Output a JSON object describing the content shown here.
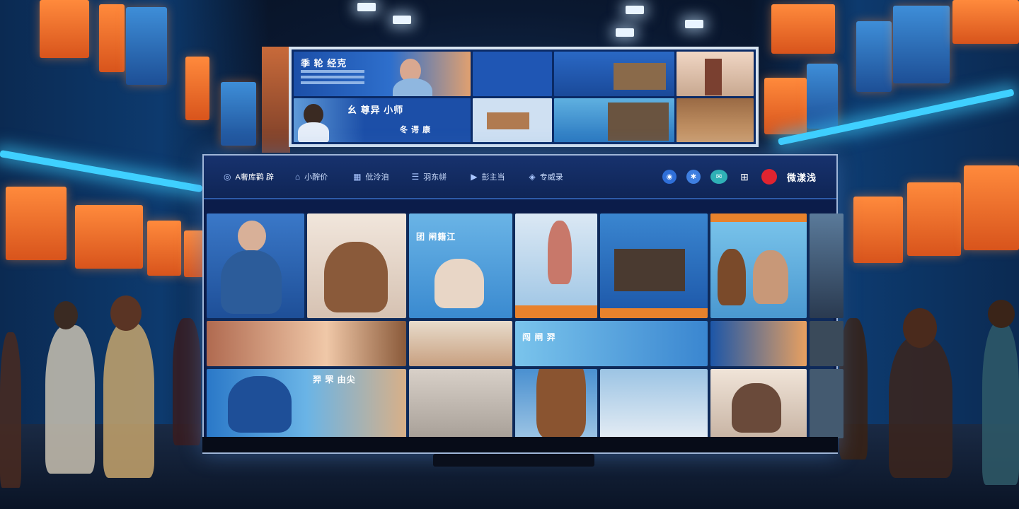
{
  "billboard": {
    "headline_1": "季 轮 经克",
    "headline_2": "幺 尊异 小师",
    "headline_3": "冬 谔 康"
  },
  "app": {
    "nav": {
      "logo_label": "A奢库鹳 辟",
      "items": [
        {
          "icon": "home-icon",
          "label": "小醡价"
        },
        {
          "icon": "grid-icon",
          "label": "仳泠洎"
        },
        {
          "icon": "list-icon",
          "label": "羽东帡"
        },
        {
          "icon": "play-icon",
          "label": "彭主当"
        },
        {
          "icon": "tag-icon",
          "label": "专威录"
        }
      ],
      "actions": [
        {
          "icon": "globe-icon",
          "color": "#2f6fd8"
        },
        {
          "icon": "bell-icon",
          "color": "#3f7fe0"
        },
        {
          "icon": "chat-icon",
          "color": "#2fb0b6"
        },
        {
          "icon": "cart-icon",
          "color": "#d9e3f2"
        },
        {
          "icon": "record-icon",
          "color": "#e02430"
        }
      ],
      "user_label": "微漾浅"
    },
    "gallery": {
      "captions": {
        "t3": "团 闸籍江",
        "t9": "闯 闸 羿",
        "t13": "羿 罘 由尖"
      }
    }
  },
  "colors": {
    "accent": "#3fd0ff",
    "brand_navy": "#0f2556",
    "warm": "#ff8a3c"
  }
}
